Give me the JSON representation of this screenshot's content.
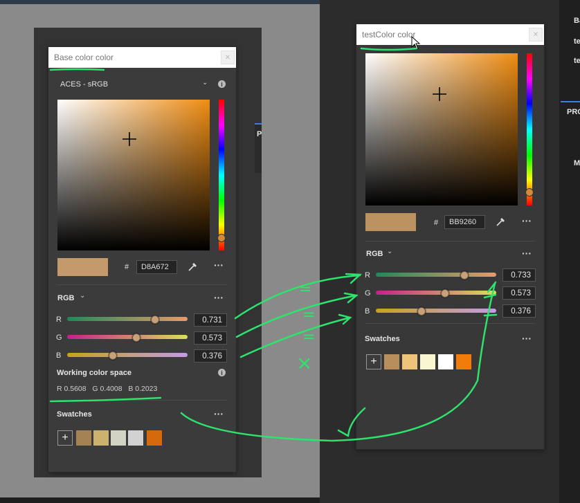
{
  "colors": {
    "left_bg": "#8a8a8a",
    "panel_bg": "#3b3b3b",
    "annotation": "#2ee36e",
    "base_swatch_preview": "#c49a6c",
    "test_swatch_preview": "#bb9260"
  },
  "base_panel": {
    "title": "Base color color",
    "color_space": "ACES - sRGB",
    "hex_label": "#",
    "hex_value": "D8A672",
    "mode_label": "RGB",
    "channels": [
      {
        "label": "R",
        "value": "0.731",
        "fraction": 0.731
      },
      {
        "label": "G",
        "value": "0.573",
        "fraction": 0.573
      },
      {
        "label": "B",
        "value": "0.376",
        "fraction": 0.376
      }
    ],
    "working_space_title": "Working color space",
    "working_space_values": "R 0.5608   G 0.4008   B 0.2023",
    "swatches_title": "Swatches",
    "swatches": [
      "#a58254",
      "#cdb26e",
      "#d3d3c3",
      "#d2d2d2",
      "#d46a0c"
    ]
  },
  "test_panel": {
    "title": "testColor color",
    "hex_label": "#",
    "hex_value": "BB9260",
    "mode_label": "RGB",
    "channels": [
      {
        "label": "R",
        "value": "0.733",
        "fraction": 0.733
      },
      {
        "label": "G",
        "value": "0.573",
        "fraction": 0.573
      },
      {
        "label": "B",
        "value": "0.376",
        "fraction": 0.376
      }
    ],
    "swatches_title": "Swatches",
    "swatches": [
      "#b88e5c",
      "#edc47a",
      "#fbf6d2",
      "#ffffff",
      "#f27c0a"
    ]
  },
  "annotations": {
    "eq1": "=",
    "eq2": "=",
    "eq3": "=",
    "mismatch": "×"
  },
  "right_edge": {
    "items": [
      "Ba",
      "te",
      "te"
    ],
    "partial_label": "PRO",
    "partial_label2": "M"
  },
  "middle_strip": {
    "label": "P"
  }
}
